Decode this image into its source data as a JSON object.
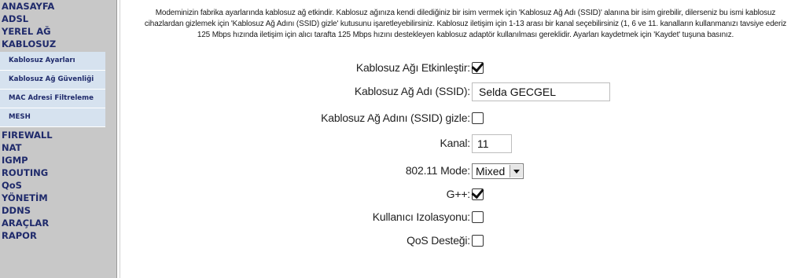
{
  "nav": {
    "items": [
      "ANASAYFA",
      "ADSL",
      "YEREL AĞ",
      "KABLOSUZ"
    ],
    "sub_items": [
      "Kablosuz Ayarları",
      "Kablosuz Ağ Güvenliği",
      "MAC Adresi Filtreleme",
      "MESH"
    ],
    "items_after": [
      "FIREWALL",
      "NAT",
      "IGMP",
      "ROUTING",
      "QoS",
      "YÖNETİM",
      "DDNS",
      "ARAÇLAR",
      "RAPOR"
    ]
  },
  "intro": {
    "line1": "Modeminizin fabrika ayarlarında kablosuz ağ etkindir. Kablosuz ağınıza kendi dilediğiniz bir isim vermek için 'Kablosuz Ağ Adı (SSID)' alanına bir isim girebilir, dilerseniz bu ismi kablosuz",
    "line2": "cihazlardan gizlemek için 'Kablosuz Ağ Adını (SSID) gizle' kutusunu işaretleyebilirsiniz. Kablosuz iletişim için 1-13 arası bir kanal seçebilirsiniz (1, 6 ve 11. kanalların kullanmanızı tavsiye ederiz",
    "line3": "125 Mbps hızında iletişim için alıcı tarafta 125 Mbps hızını destekleyen kablosuz adaptör kullanılması gereklidir. Ayarları kaydetmek için 'Kaydet' tuşuna basınız."
  },
  "form": {
    "enable_label": "Kablosuz Ağı Etkinleştir:",
    "enable_checked": true,
    "ssid_label": "Kablosuz Ağ Adı (SSID):",
    "ssid_value": "Selda GECGEL",
    "hide_label": "Kablosuz Ağ Adını (SSID) gizle:",
    "hide_checked": false,
    "channel_label": "Kanal:",
    "channel_value": "11",
    "mode_label": "802.11 Mode:",
    "mode_value": "Mixed",
    "gpp_label": "G++:",
    "gpp_checked": true,
    "isolation_label": "Kullanıcı Izolasyonu:",
    "isolation_checked": false,
    "qos_label": "QoS Desteği:",
    "qos_checked": false
  },
  "colors": {
    "sidebar_bg": "#c8c8c8",
    "nav_text": "#1f2a6b",
    "submenu_bg": "#d6e2ef"
  }
}
